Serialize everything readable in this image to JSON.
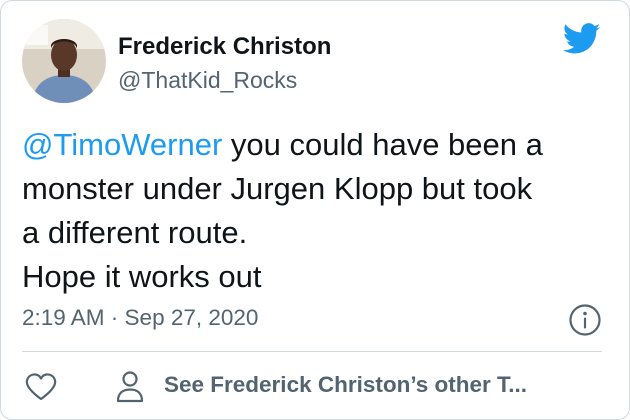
{
  "author": {
    "name": "Frederick Christon",
    "handle": "@ThatKid_Rocks"
  },
  "tweet": {
    "mention": "@TimoWerner",
    "line1_rest": " you could have been a",
    "line2": "monster under Jurgen Klopp but took",
    "line3": "a different route.",
    "line4": "Hope it works out"
  },
  "timestamp": "2:19 AM · Sep 27, 2020",
  "actions": {
    "other_tweets_label": "See Frederick Christon’s other T..."
  },
  "icons": {
    "brand": "twitter-bird-icon",
    "info": "info-icon",
    "like": "heart-icon",
    "profile": "person-icon"
  },
  "colors": {
    "brand_blue": "#1d9bf0",
    "text_primary": "#0f1419",
    "text_secondary": "#536471",
    "border": "#cfd9de"
  }
}
